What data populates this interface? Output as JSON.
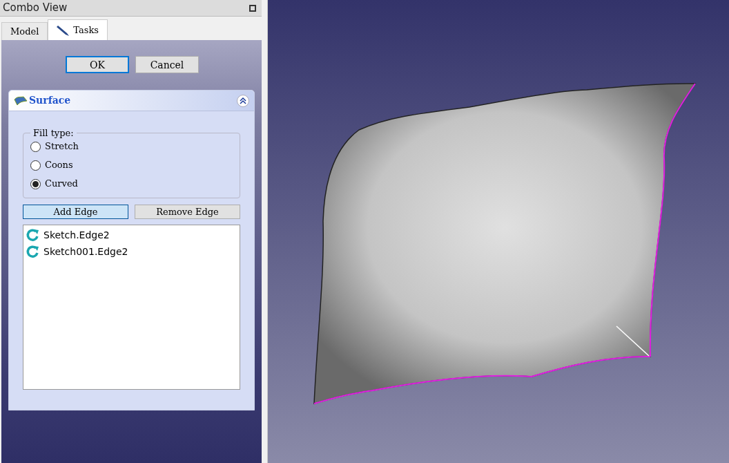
{
  "panel": {
    "title": "Combo View"
  },
  "tabs": [
    {
      "label": "Model",
      "selected": false,
      "icon": false
    },
    {
      "label": "Tasks",
      "selected": true,
      "icon": true
    }
  ],
  "dialog_buttons": [
    {
      "label": "OK",
      "focused": true
    },
    {
      "label": "Cancel",
      "focused": false
    }
  ],
  "task_box": {
    "title": "Surface",
    "expanded": true
  },
  "fill_type": {
    "legend": "Fill type:",
    "options": [
      {
        "label": "Stretch",
        "selected": false
      },
      {
        "label": "Coons",
        "selected": false
      },
      {
        "label": "Curved",
        "selected": true
      }
    ]
  },
  "edge_buttons": [
    {
      "label": "Add Edge",
      "checked": true
    },
    {
      "label": "Remove Edge",
      "checked": false
    }
  ],
  "edges": [
    "Sketch.Edge2",
    "Sketch001.Edge2"
  ]
}
